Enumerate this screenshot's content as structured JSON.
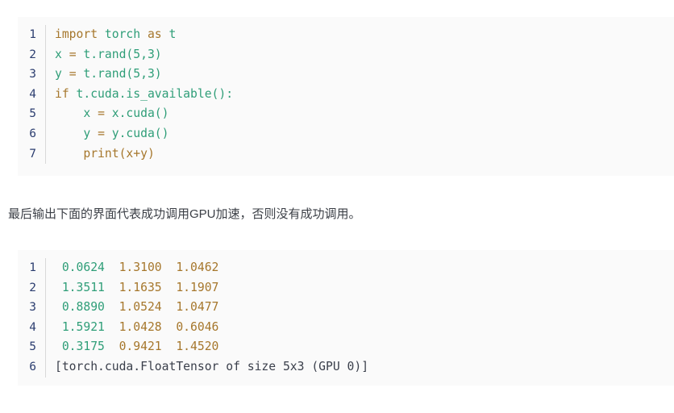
{
  "code_block": {
    "language": "python",
    "background": "#fafafa",
    "line_number_color": "#2c3e70",
    "lines": [
      {
        "number": "1",
        "indent": "",
        "tokens": [
          {
            "text": "import",
            "kind": "keyword"
          },
          {
            "text": " ",
            "kind": "plain"
          },
          {
            "text": "torch",
            "kind": "name"
          },
          {
            "text": " ",
            "kind": "plain"
          },
          {
            "text": "as",
            "kind": "keyword"
          },
          {
            "text": " ",
            "kind": "plain"
          },
          {
            "text": "t",
            "kind": "name"
          }
        ]
      },
      {
        "number": "2",
        "indent": "",
        "tokens": [
          {
            "text": "x",
            "kind": "name"
          },
          {
            "text": " ",
            "kind": "plain"
          },
          {
            "text": "=",
            "kind": "keyword"
          },
          {
            "text": " ",
            "kind": "plain"
          },
          {
            "text": "t.rand(5,3)",
            "kind": "name"
          }
        ]
      },
      {
        "number": "3",
        "indent": "",
        "tokens": [
          {
            "text": "y",
            "kind": "name"
          },
          {
            "text": " ",
            "kind": "plain"
          },
          {
            "text": "=",
            "kind": "keyword"
          },
          {
            "text": " ",
            "kind": "plain"
          },
          {
            "text": "t.rand(5,3)",
            "kind": "name"
          }
        ]
      },
      {
        "number": "4",
        "indent": "",
        "tokens": [
          {
            "text": "if",
            "kind": "keyword"
          },
          {
            "text": " ",
            "kind": "plain"
          },
          {
            "text": "t.cuda.is_available():",
            "kind": "name"
          }
        ]
      },
      {
        "number": "5",
        "indent": "    ",
        "tokens": [
          {
            "text": "x",
            "kind": "name"
          },
          {
            "text": " ",
            "kind": "plain"
          },
          {
            "text": "=",
            "kind": "keyword"
          },
          {
            "text": " ",
            "kind": "plain"
          },
          {
            "text": "x.cuda()",
            "kind": "name"
          }
        ]
      },
      {
        "number": "6",
        "indent": "    ",
        "tokens": [
          {
            "text": "y",
            "kind": "name"
          },
          {
            "text": " ",
            "kind": "plain"
          },
          {
            "text": "=",
            "kind": "keyword"
          },
          {
            "text": " ",
            "kind": "plain"
          },
          {
            "text": "y.cuda()",
            "kind": "name"
          }
        ]
      },
      {
        "number": "7",
        "indent": "    ",
        "tokens": [
          {
            "text": "print(x+y)",
            "kind": "keyword"
          }
        ]
      }
    ]
  },
  "paragraph": {
    "text": "最后输出下面的界面代表成功调用GPU加速，否则没有成功调用。"
  },
  "output_block": {
    "background": "#fafafa",
    "line_number_color": "#2c3e70",
    "lines": [
      {
        "number": "1",
        "indent": " ",
        "tokens": [
          {
            "text": "0.0624",
            "kind": "num-first"
          },
          {
            "text": "  ",
            "kind": "plain"
          },
          {
            "text": "1.3100",
            "kind": "num"
          },
          {
            "text": "  ",
            "kind": "plain"
          },
          {
            "text": "1.0462",
            "kind": "num"
          }
        ]
      },
      {
        "number": "2",
        "indent": " ",
        "tokens": [
          {
            "text": "1.3511",
            "kind": "num-first"
          },
          {
            "text": "  ",
            "kind": "plain"
          },
          {
            "text": "1.1635",
            "kind": "num"
          },
          {
            "text": "  ",
            "kind": "plain"
          },
          {
            "text": "1.1907",
            "kind": "num"
          }
        ]
      },
      {
        "number": "3",
        "indent": " ",
        "tokens": [
          {
            "text": "0.8890",
            "kind": "num-first"
          },
          {
            "text": "  ",
            "kind": "plain"
          },
          {
            "text": "1.0524",
            "kind": "num"
          },
          {
            "text": "  ",
            "kind": "plain"
          },
          {
            "text": "1.0477",
            "kind": "num"
          }
        ]
      },
      {
        "number": "4",
        "indent": " ",
        "tokens": [
          {
            "text": "1.5921",
            "kind": "num-first"
          },
          {
            "text": "  ",
            "kind": "plain"
          },
          {
            "text": "1.0428",
            "kind": "num"
          },
          {
            "text": "  ",
            "kind": "plain"
          },
          {
            "text": "0.6046",
            "kind": "num"
          }
        ]
      },
      {
        "number": "5",
        "indent": " ",
        "tokens": [
          {
            "text": "0.3175",
            "kind": "num-first"
          },
          {
            "text": "  ",
            "kind": "plain"
          },
          {
            "text": "0.9421",
            "kind": "num"
          },
          {
            "text": "  ",
            "kind": "plain"
          },
          {
            "text": "1.4520",
            "kind": "num"
          }
        ]
      },
      {
        "number": "6",
        "indent": "",
        "tokens": [
          {
            "text": "[torch.cuda.FloatTensor of size 5x3 (GPU 0)]",
            "kind": "plain-text"
          }
        ]
      }
    ]
  }
}
